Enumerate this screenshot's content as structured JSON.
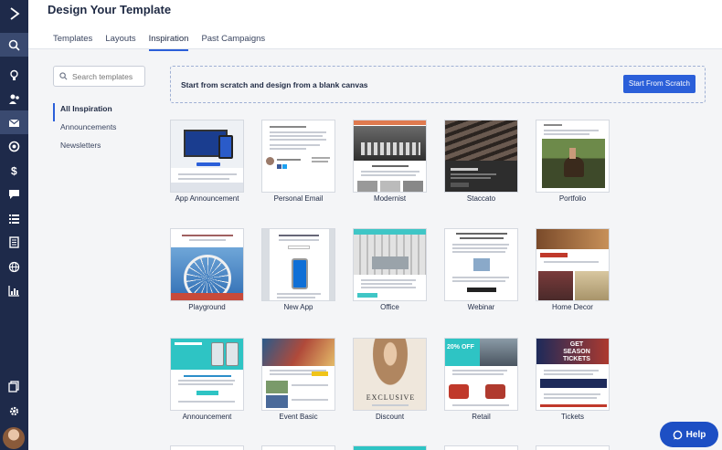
{
  "header": {
    "title": "Design Your Template",
    "tabs": [
      {
        "label": "Templates"
      },
      {
        "label": "Layouts"
      },
      {
        "label": "Inspiration"
      },
      {
        "label": "Past Campaigns"
      }
    ]
  },
  "sidebar": {
    "search_placeholder": "Search templates",
    "categories": [
      {
        "label": "All Inspiration"
      },
      {
        "label": "Announcements"
      },
      {
        "label": "Newsletters"
      }
    ]
  },
  "scratch": {
    "text": "Start from scratch and design from a blank canvas",
    "button": "Start From Scratch"
  },
  "templates": [
    {
      "name": "App Announcement"
    },
    {
      "name": "Personal Email"
    },
    {
      "name": "Modernist"
    },
    {
      "name": "Staccato"
    },
    {
      "name": "Portfolio"
    },
    {
      "name": "Playground"
    },
    {
      "name": "New App"
    },
    {
      "name": "Office"
    },
    {
      "name": "Webinar"
    },
    {
      "name": "Home Decor"
    },
    {
      "name": "Announcement"
    },
    {
      "name": "Event Basic"
    },
    {
      "name": "Discount"
    },
    {
      "name": "Retail"
    },
    {
      "name": "Tickets"
    }
  ],
  "thumb_text": {
    "retail_badge": "20% OFF",
    "tickets_banner": "GET SEASON TICKETS",
    "discount_word": "EXCLUSIVE"
  },
  "help": {
    "label": "Help"
  },
  "colors": {
    "rail": "#1e2a4a",
    "accent": "#2b5fd9",
    "help": "#1d4fc4"
  }
}
